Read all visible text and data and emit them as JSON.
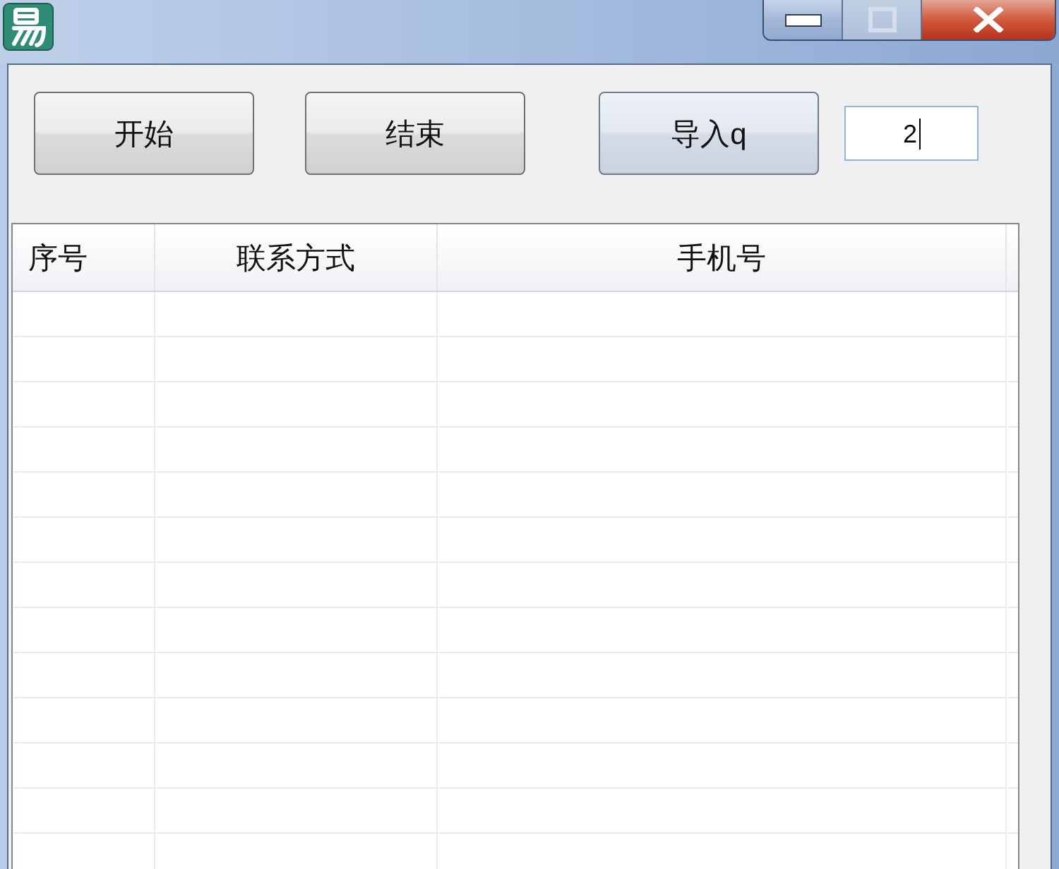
{
  "window": {
    "maximize_disabled": true
  },
  "toolbar": {
    "buttons": [
      {
        "label": "开始",
        "highlighted": false
      },
      {
        "label": "结束",
        "highlighted": false
      },
      {
        "label": "导入q",
        "highlighted": true
      }
    ],
    "input": {
      "value": "2",
      "focused": true
    }
  },
  "table": {
    "columns": [
      {
        "label": "序号"
      },
      {
        "label": "联系方式"
      },
      {
        "label": "手机号"
      }
    ]
  }
}
